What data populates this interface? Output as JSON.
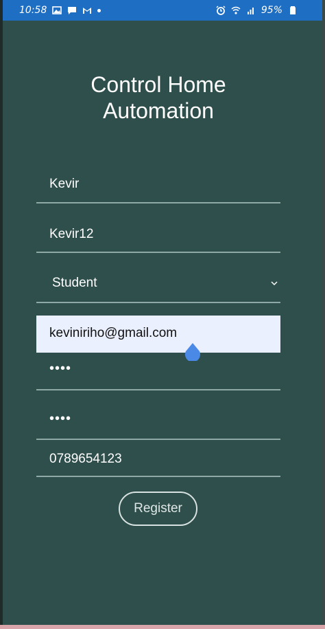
{
  "status_bar": {
    "time": "10:58",
    "battery": "95%",
    "left_icons": [
      "image-icon",
      "message-icon",
      "gmail-icon",
      "dot-icon"
    ],
    "right_icons": [
      "alarm-icon",
      "wifi-icon",
      "signal-icon",
      "battery-icon"
    ],
    "color": "#1e6fc4"
  },
  "page": {
    "title_line1": "Control Home",
    "title_line2": "Automation",
    "background": "#2f4f4c"
  },
  "form": {
    "username": "Kevir",
    "user_id": "Kevir12",
    "role": "Student",
    "email": "keviniriho@gmail.com",
    "password": "••••",
    "confirm_password": "••••",
    "phone": "0789654123",
    "register_label": "Register"
  }
}
